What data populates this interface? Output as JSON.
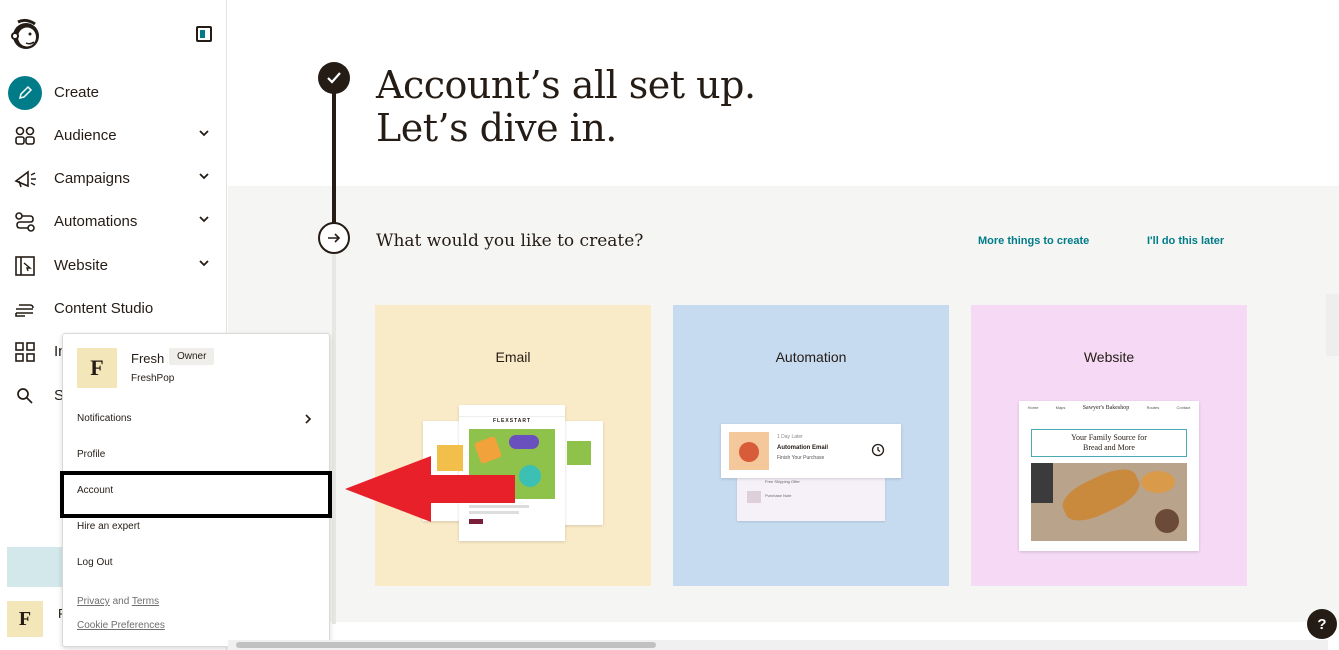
{
  "sidebar": {
    "items": [
      {
        "label": "Create",
        "icon": "pencil-icon",
        "has_chevron": false
      },
      {
        "label": "Audience",
        "icon": "audience-icon",
        "has_chevron": true
      },
      {
        "label": "Campaigns",
        "icon": "megaphone-icon",
        "has_chevron": true
      },
      {
        "label": "Automations",
        "icon": "automations-icon",
        "has_chevron": true
      },
      {
        "label": "Website",
        "icon": "website-icon",
        "has_chevron": true
      },
      {
        "label": "Content Studio",
        "icon": "content-studio-icon",
        "has_chevron": false
      },
      {
        "label": "In",
        "icon": "grid-icon",
        "has_chevron": false
      },
      {
        "label": "S",
        "icon": "search-icon",
        "has_chevron": false
      }
    ],
    "account_initial": "F",
    "account_tail": "F"
  },
  "main": {
    "headline_line1": "Account’s all set up.",
    "headline_line2": "Let’s dive in.",
    "question": "What would you like to create?",
    "links": {
      "more": "More things to create",
      "later": "I'll do this later"
    },
    "cards": [
      {
        "title": "Email",
        "bg": "#faebc8"
      },
      {
        "title": "Automation",
        "bg": "#c6daf0"
      },
      {
        "title": "Website",
        "bg": "#f5d9f5"
      }
    ],
    "email_illus": {
      "brand": "FLEXSTART"
    },
    "automation_illus": {
      "delay": "1 Day Later",
      "title": "Automation Email",
      "subtitle": "Finish Your Purchase",
      "line2": "Free Shipping Offer",
      "line3": "Purchase Note"
    },
    "website_illus": {
      "nav": [
        "Home",
        "Maps",
        "Sawyer's Bakeshop",
        "Routes",
        "Contact"
      ],
      "heading": "Your Family Source for Bread and More"
    }
  },
  "dropdown": {
    "avatar_initial": "F",
    "name": "Fresh",
    "badge": "Owner",
    "org": "FreshPop",
    "items": [
      "Notifications",
      "Profile",
      "Account",
      "Hire an expert",
      "Log Out"
    ],
    "footer_privacy": "Privacy",
    "footer_and": "and",
    "footer_terms": "Terms",
    "footer_cookies": "Cookie Preferences"
  },
  "help_label": "?",
  "colors": {
    "accent": "#007c89",
    "dark": "#241c15",
    "arrow_red": "#e8202a"
  }
}
